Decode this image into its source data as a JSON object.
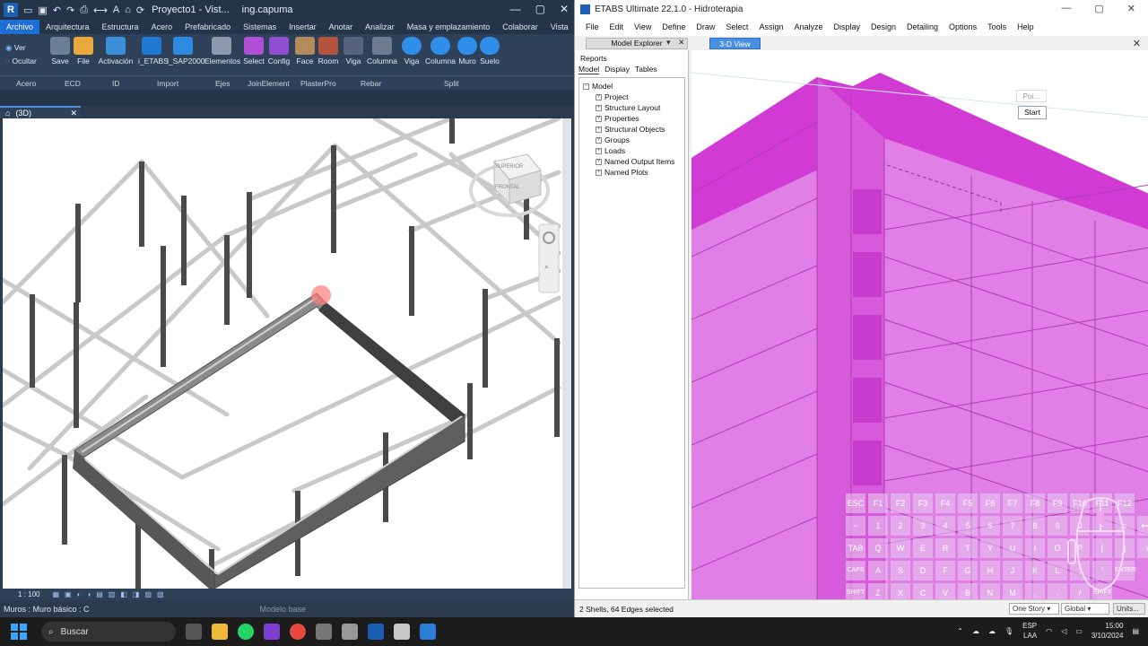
{
  "revit": {
    "qat_icons": [
      "open-icon",
      "save-icon",
      "undo-icon",
      "redo-icon",
      "print-icon",
      "measure-icon",
      "text-icon",
      "home-icon",
      "sync-icon"
    ],
    "title": "Proyecto1 - Vist...",
    "user": "ing.capuma",
    "tabs": [
      "Archivo",
      "Arquitectura",
      "Estructura",
      "Acero",
      "Prefabricado",
      "Sistemas",
      "Insertar",
      "Anotar",
      "Analizar",
      "Masa y emplazamiento",
      "Colaborar",
      "Vista"
    ],
    "active_tab": "Archivo",
    "ver_label": "Ver",
    "ocultar_label": "Ocultar",
    "ribbon_buttons": [
      "Save",
      "File",
      "Activación",
      "i_ETABS",
      "i_SAP2000",
      "Elementos",
      "Select",
      "Config",
      "Face",
      "Room",
      "Viga",
      "Columna",
      "Viga",
      "Columna",
      "Muro",
      "Suelo"
    ],
    "ribbon_panels": [
      "Acero",
      "ECD",
      "ID",
      "Import",
      "Ejes",
      "JoinElement",
      "PlasterPro",
      "Rebar",
      "Split"
    ],
    "view_tab": "(3D)",
    "viewcube_top": "SUPERIOR",
    "viewcube_front": "FRONTAL",
    "scale": "1 : 100",
    "status_left": "Muros : Muro básico : C",
    "status_model": "Modelo base"
  },
  "etabs": {
    "title": "ETABS Ultimate 22.1.0 - Hidroterapia",
    "menus": [
      "File",
      "Edit",
      "View",
      "Define",
      "Draw",
      "Select",
      "Assign",
      "Analyze",
      "Display",
      "Design",
      "Detailing",
      "Options",
      "Tools",
      "Help"
    ],
    "explorer_title": "Model Explorer",
    "view_title": "3-D View",
    "reports": "Reports",
    "subtabs": [
      "Model",
      "Display",
      "Tables"
    ],
    "tree_root": "Model",
    "tree_items": [
      "Project",
      "Structure Layout",
      "Properties",
      "Structural Objects",
      "Groups",
      "Loads",
      "Named Output Items",
      "Named Plots"
    ],
    "popup_label": "Poi...",
    "start_label": "Start",
    "status_text": "2 Shells, 64 Edges selected",
    "story_combo": "One Story",
    "global_combo": "Global",
    "units_button": "Units...",
    "colors": {
      "shell_magenta": "#d640d8",
      "shell_light": "#e280e6"
    }
  },
  "keyboard": {
    "rows": [
      [
        "ESC",
        "F1",
        "F2",
        "F3",
        "F4",
        "F5",
        "F6",
        "F7",
        "F8",
        "F9",
        "F10",
        "F11",
        "F12"
      ],
      [
        "~",
        "1",
        "2",
        "3",
        "4",
        "5",
        "6",
        "7",
        "8",
        "9",
        "0",
        "-",
        "=",
        "⟵"
      ],
      [
        "TAB",
        "Q",
        "W",
        "E",
        "R",
        "T",
        "Y",
        "U",
        "I",
        "O",
        "P",
        "[",
        "]",
        "\\"
      ],
      [
        "CAPS",
        "A",
        "S",
        "D",
        "F",
        "G",
        "H",
        "J",
        "K",
        "L",
        ";",
        "'",
        "ENTER"
      ],
      [
        "SHIFT",
        "Z",
        "X",
        "C",
        "V",
        "B",
        "N",
        "M",
        ",",
        ".",
        "/",
        "SHIFT"
      ],
      [
        "CTRL",
        "WIN",
        "ALT",
        "ALT",
        "WIN"
      ]
    ]
  },
  "taskbar": {
    "search_label": "Buscar",
    "lang_top": "ESP",
    "lang_bottom": "LAA",
    "time": "15:00",
    "date": "3/10/2024"
  }
}
